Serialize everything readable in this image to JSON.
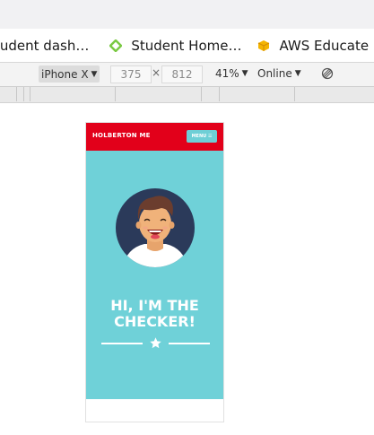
{
  "bookmarks": [
    {
      "label": "tudent dash…",
      "icon": "none"
    },
    {
      "label": "Student Home…",
      "icon": "green-diamond-icon"
    },
    {
      "label": "AWS Educate",
      "icon": "yellow-box-icon"
    },
    {
      "label": "",
      "icon": "orange-box-icon"
    }
  ],
  "device_toolbar": {
    "device": "iPhone X",
    "width": "375",
    "times": "×",
    "height": "812",
    "zoom": "41%",
    "network": "Online"
  },
  "site": {
    "brand": "HOLBERTON ME",
    "menu_label": "MENU ☰",
    "hero_line1": "HI, I'M THE",
    "hero_line2": "CHECKER!"
  },
  "colors": {
    "header_red": "#e2001a",
    "hero_teal": "#6fd1d8",
    "menu_teal": "#6ecfd6",
    "avatar_bg": "#2b3a5a",
    "skin": "#f0b27a",
    "hair": "#6b3d2e"
  }
}
